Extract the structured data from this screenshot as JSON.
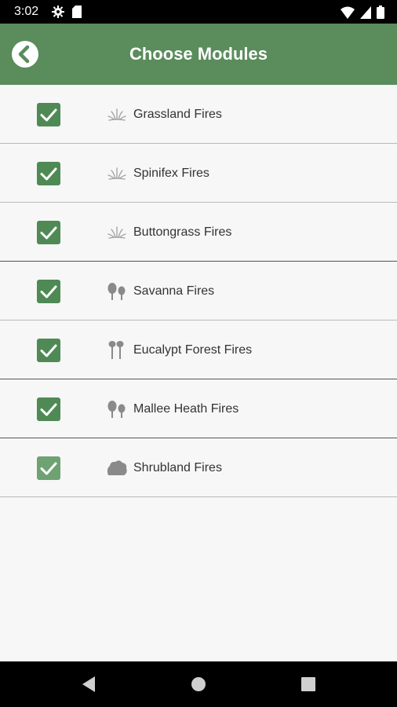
{
  "status_bar": {
    "time": "3:02",
    "icons": [
      "settings-gear-icon",
      "sd-card-icon",
      "wifi-icon",
      "cell-signal-icon",
      "battery-icon"
    ]
  },
  "header": {
    "title": "Choose Modules",
    "back_icon": "back-arrow-circle-icon",
    "background_color": "#5a8c5c"
  },
  "modules": [
    {
      "label": "Grassland Fires",
      "icon": "grass-icon",
      "checked": true
    },
    {
      "label": "Spinifex Fires",
      "icon": "grass-icon",
      "checked": true
    },
    {
      "label": "Buttongrass Fires",
      "icon": "grass-icon",
      "checked": true
    },
    {
      "label": "Savanna Fires",
      "icon": "trees-icon",
      "checked": true
    },
    {
      "label": "Eucalypt Forest Fires",
      "icon": "eucalypt-trees-icon",
      "checked": true
    },
    {
      "label": "Mallee Heath Fires",
      "icon": "trees-icon",
      "checked": true
    },
    {
      "label": "Shrubland Fires",
      "icon": "shrub-icon",
      "checked": true
    }
  ],
  "checkbox_color": "#4f8a55",
  "nav_bar": {
    "icons": [
      "back-triangle-icon",
      "home-circle-icon",
      "recents-square-icon"
    ]
  }
}
